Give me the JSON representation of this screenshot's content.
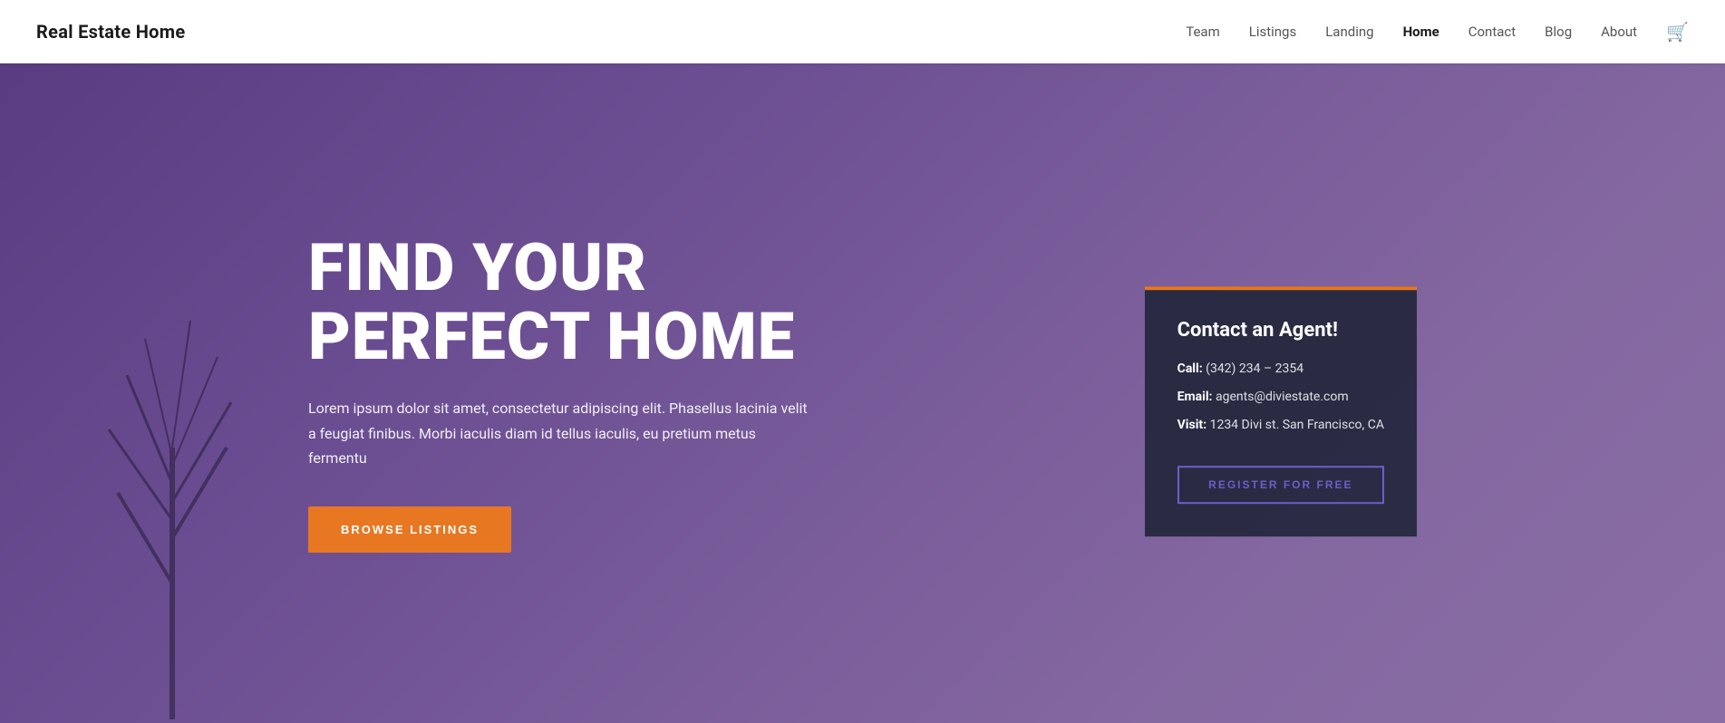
{
  "header": {
    "logo": "Real Estate Home",
    "nav": {
      "items": [
        {
          "label": "Team",
          "active": false,
          "id": "team"
        },
        {
          "label": "Listings",
          "active": false,
          "id": "listings"
        },
        {
          "label": "Landing",
          "active": false,
          "id": "landing"
        },
        {
          "label": "Home",
          "active": true,
          "id": "home"
        },
        {
          "label": "Contact",
          "active": false,
          "id": "contact"
        },
        {
          "label": "Blog",
          "active": false,
          "id": "blog"
        },
        {
          "label": "About",
          "active": false,
          "id": "about"
        }
      ]
    }
  },
  "hero": {
    "title_line1": "FIND YOUR",
    "title_line2": "PERFECT HOME",
    "subtitle": "Lorem ipsum dolor sit amet, consectetur adipiscing elit. Phasellus lacinia velit a feugiat finibus. Morbi iaculis diam id tellus iaculis, eu pretium metus fermentu",
    "cta_label": "BROWSE LISTINGS"
  },
  "contact_card": {
    "title": "Contact an Agent!",
    "phone_label": "Call:",
    "phone_value": "(342) 234 – 2354",
    "email_label": "Email:",
    "email_value": "agents@diviestate.com",
    "visit_label": "Visit:",
    "visit_value": "1234 Divi st. San Francisco, CA",
    "register_label": "REGISTER FOR FREE"
  },
  "colors": {
    "accent_orange": "#e87722",
    "accent_purple": "#6b5fc8",
    "hero_bg": "#7a5fa0",
    "card_bg": "rgba(30,35,55,0.88)"
  }
}
